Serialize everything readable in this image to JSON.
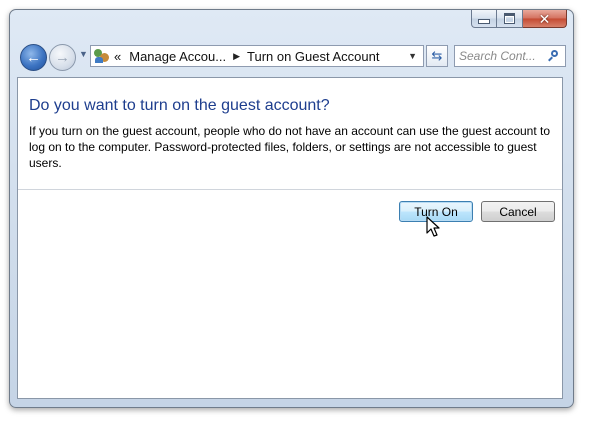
{
  "window": {
    "caption_buttons": [
      {
        "name": "minimize-button",
        "icon": "minimize-icon"
      },
      {
        "name": "maximize-button",
        "icon": "maximize-icon"
      },
      {
        "name": "close-button",
        "icon": "close-icon"
      }
    ]
  },
  "navigation": {
    "back_icon": "back-arrow-icon",
    "forward_icon": "forward-arrow-icon",
    "breadcrumb": {
      "overflow": "«",
      "items": [
        "Manage Accou...",
        "Turn on Guest Account"
      ]
    },
    "search": {
      "placeholder": "Search Cont...",
      "value": ""
    }
  },
  "content": {
    "heading": "Do you want to turn on the guest account?",
    "description": "If you turn on the guest account, people who do not have an account can use the guest account to log on to the computer. Password-protected files, folders, or settings are not accessible to guest users.",
    "buttons": {
      "primary": "Turn On",
      "secondary": "Cancel"
    }
  },
  "colors": {
    "heading": "#1e3e8e",
    "window_chrome": "#cfdceb",
    "primary_button": "#bee6fd",
    "close_button": "#c44a32"
  }
}
